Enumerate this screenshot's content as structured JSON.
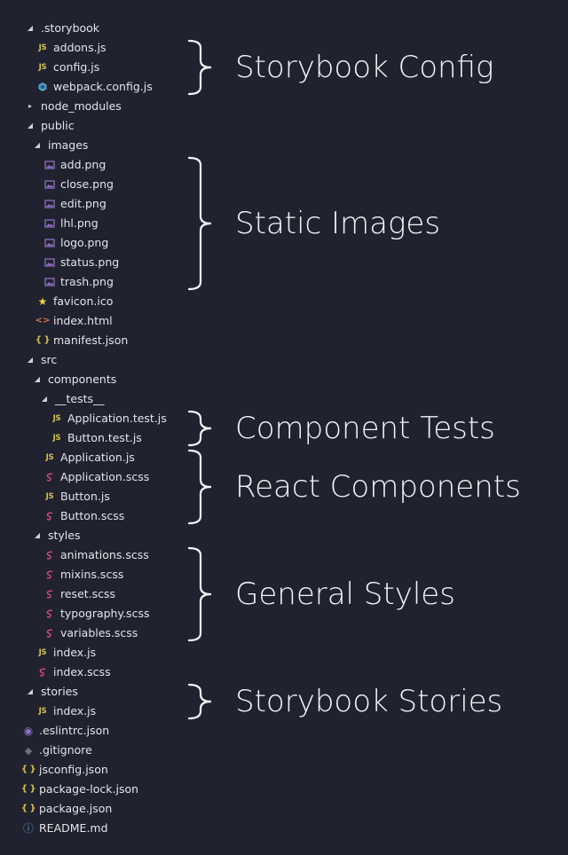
{
  "colors": {
    "background": "#21222f",
    "text": "#e4e4ea",
    "js": "#d6c34a",
    "sass": "#d5498a",
    "image": "#8f6fc2",
    "webpack": "#5db7e8"
  },
  "tree": [
    {
      "name": ".storybook",
      "depth": 0,
      "type": "folder",
      "expanded": true
    },
    {
      "name": "addons.js",
      "depth": 1,
      "type": "file",
      "icon": "js-icon"
    },
    {
      "name": "config.js",
      "depth": 1,
      "type": "file",
      "icon": "js-icon"
    },
    {
      "name": "webpack.config.js",
      "depth": 1,
      "type": "file",
      "icon": "webpack-icon"
    },
    {
      "name": "node_modules",
      "depth": 0,
      "type": "folder",
      "expanded": false
    },
    {
      "name": "public",
      "depth": 0,
      "type": "folder",
      "expanded": true
    },
    {
      "name": "images",
      "depth": 1,
      "type": "folder",
      "expanded": true
    },
    {
      "name": "add.png",
      "depth": 2,
      "type": "file",
      "icon": "image-icon"
    },
    {
      "name": "close.png",
      "depth": 2,
      "type": "file",
      "icon": "image-icon"
    },
    {
      "name": "edit.png",
      "depth": 2,
      "type": "file",
      "icon": "image-icon"
    },
    {
      "name": "lhl.png",
      "depth": 2,
      "type": "file",
      "icon": "image-icon"
    },
    {
      "name": "logo.png",
      "depth": 2,
      "type": "file",
      "icon": "image-icon"
    },
    {
      "name": "status.png",
      "depth": 2,
      "type": "file",
      "icon": "image-icon"
    },
    {
      "name": "trash.png",
      "depth": 2,
      "type": "file",
      "icon": "image-icon"
    },
    {
      "name": "favicon.ico",
      "depth": 1,
      "type": "file",
      "icon": "star-icon"
    },
    {
      "name": "index.html",
      "depth": 1,
      "type": "file",
      "icon": "html-icon"
    },
    {
      "name": "manifest.json",
      "depth": 1,
      "type": "file",
      "icon": "json-icon"
    },
    {
      "name": "src",
      "depth": 0,
      "type": "folder",
      "expanded": true
    },
    {
      "name": "components",
      "depth": 1,
      "type": "folder",
      "expanded": true
    },
    {
      "name": "__tests__",
      "depth": 2,
      "type": "folder",
      "expanded": true
    },
    {
      "name": "Application.test.js",
      "depth": 3,
      "type": "file",
      "icon": "js-icon"
    },
    {
      "name": "Button.test.js",
      "depth": 3,
      "type": "file",
      "icon": "js-icon"
    },
    {
      "name": "Application.js",
      "depth": 2,
      "type": "file",
      "icon": "js-icon"
    },
    {
      "name": "Application.scss",
      "depth": 2,
      "type": "file",
      "icon": "sass-icon"
    },
    {
      "name": "Button.js",
      "depth": 2,
      "type": "file",
      "icon": "js-icon"
    },
    {
      "name": "Button.scss",
      "depth": 2,
      "type": "file",
      "icon": "sass-icon"
    },
    {
      "name": "styles",
      "depth": 1,
      "type": "folder",
      "expanded": true
    },
    {
      "name": "animations.scss",
      "depth": 2,
      "type": "file",
      "icon": "sass-icon"
    },
    {
      "name": "mixins.scss",
      "depth": 2,
      "type": "file",
      "icon": "sass-icon"
    },
    {
      "name": "reset.scss",
      "depth": 2,
      "type": "file",
      "icon": "sass-icon"
    },
    {
      "name": "typography.scss",
      "depth": 2,
      "type": "file",
      "icon": "sass-icon"
    },
    {
      "name": "variables.scss",
      "depth": 2,
      "type": "file",
      "icon": "sass-icon"
    },
    {
      "name": "index.js",
      "depth": 1,
      "type": "file",
      "icon": "js-icon"
    },
    {
      "name": "index.scss",
      "depth": 1,
      "type": "file",
      "icon": "sass-icon"
    },
    {
      "name": "stories",
      "depth": 0,
      "type": "folder",
      "expanded": true
    },
    {
      "name": "index.js",
      "depth": 1,
      "type": "file",
      "icon": "js-icon"
    },
    {
      "name": ".eslintrc.json",
      "depth": 0,
      "type": "file",
      "icon": "eslint-icon"
    },
    {
      "name": ".gitignore",
      "depth": 0,
      "type": "file",
      "icon": "git-icon"
    },
    {
      "name": "jsconfig.json",
      "depth": 0,
      "type": "file",
      "icon": "json-icon"
    },
    {
      "name": "package-lock.json",
      "depth": 0,
      "type": "file",
      "icon": "json-icon"
    },
    {
      "name": "package.json",
      "depth": 0,
      "type": "file",
      "icon": "json-icon"
    },
    {
      "name": "README.md",
      "depth": 0,
      "type": "file",
      "icon": "info-icon"
    }
  ],
  "annotations": [
    {
      "text": "Storybook Config",
      "from": 1,
      "to": 3
    },
    {
      "text": "Static Images",
      "from": 7,
      "to": 13
    },
    {
      "text": "Component Tests",
      "from": 20,
      "to": 21
    },
    {
      "text": "React Components",
      "from": 22,
      "to": 25
    },
    {
      "text": "General Styles",
      "from": 27,
      "to": 31
    },
    {
      "text": "Storybook Stories",
      "from": 34,
      "to": 35
    }
  ]
}
